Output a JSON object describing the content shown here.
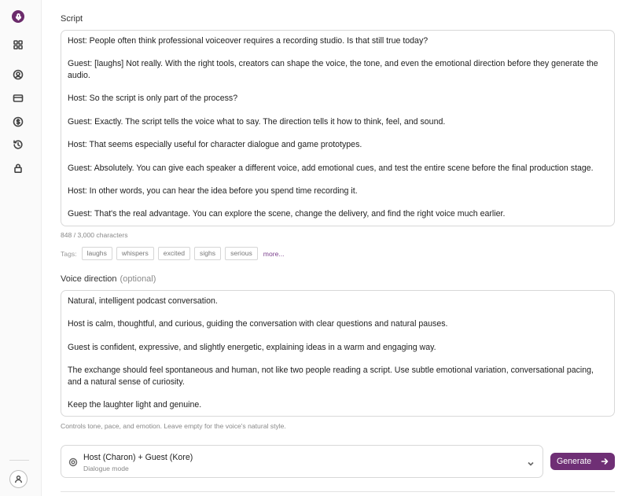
{
  "sidebar": {
    "icons": [
      "microphone-logo",
      "grid-icon",
      "user-circle-icon",
      "card-icon",
      "dollar-icon",
      "history-icon",
      "lock-icon",
      "user-icon"
    ]
  },
  "script": {
    "label": "Script",
    "lines": [
      "Host: People often think professional voiceover requires a recording studio. Is that still true today?",
      "Guest: [laughs] Not really. With the right tools, creators can shape the voice, the tone, and even the emotional direction before they generate the audio.",
      "Host: So the script is only part of the process?",
      "Guest: Exactly. The script tells the voice what to say. The direction tells it how to think, feel, and sound.",
      "Host: That seems especially useful for character dialogue and game prototypes.",
      "Guest: Absolutely. You can give each speaker a different voice, add emotional cues, and test the entire scene before the final production stage.",
      "Host: In other words, you can hear the idea before you spend time recording it.",
      "Guest: That's the real advantage. You can explore the scene, change the delivery, and find the right voice much earlier."
    ],
    "char_count": "848 / 3,000 characters"
  },
  "tags": {
    "label": "Tags:",
    "items": [
      "laughs",
      "whispers",
      "excited",
      "sighs",
      "serious"
    ],
    "more": "more..."
  },
  "direction": {
    "label": "Voice direction",
    "optional": "(optional)",
    "lines": [
      "Natural, intelligent podcast conversation.",
      "Host is calm, thoughtful, and curious, guiding the conversation with clear questions and natural pauses.",
      "Guest is confident, expressive, and slightly energetic, explaining ideas in a warm and engaging way.",
      "The exchange should feel spontaneous and human, not like two people reading a script. Use subtle emotional variation, conversational pacing, and a natural sense of curiosity.",
      "Keep the laughter light and genuine."
    ],
    "help": "Controls tone, pace, and emotion. Leave empty for the voice's natural style."
  },
  "voice": {
    "name": "Host (Charon) + Guest (Kore)",
    "mode": "Dialogue mode"
  },
  "generate": {
    "label": "Generate"
  },
  "colors": {
    "accent": "#6f2f75",
    "logo": "#6b2b6b"
  }
}
